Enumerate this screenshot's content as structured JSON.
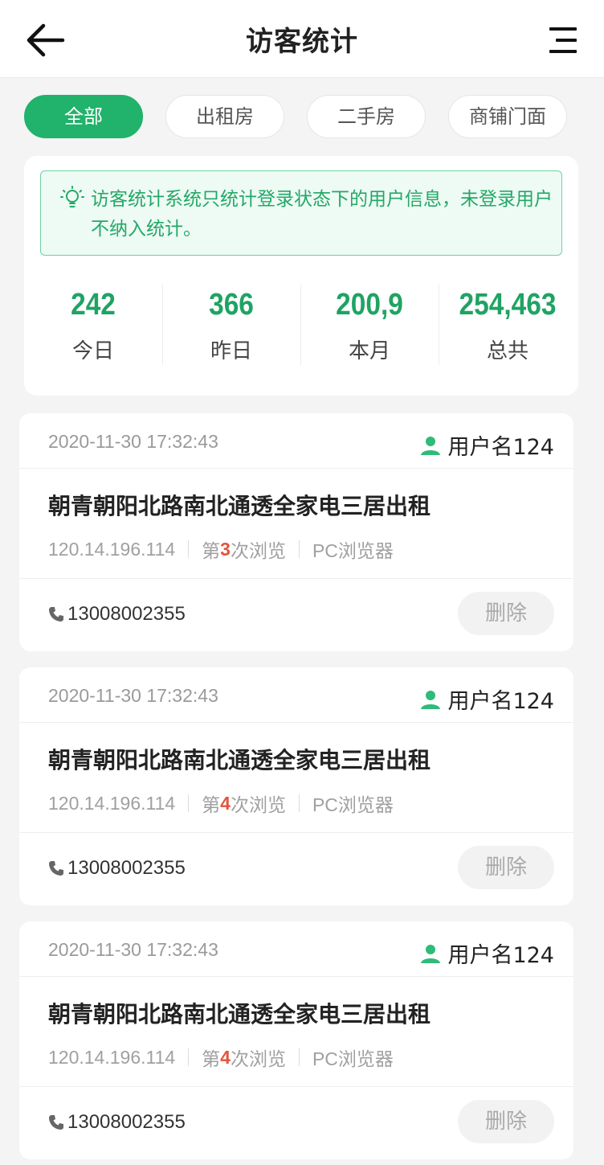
{
  "header": {
    "title": "访客统计"
  },
  "filters": [
    "全部",
    "出租房",
    "二手房",
    "商铺门面"
  ],
  "notice": {
    "text": "访客统计系统只统计登录状态下的用户信息，未登录用户不纳入统计。"
  },
  "stats": [
    {
      "value": "242",
      "label": "今日"
    },
    {
      "value": "366",
      "label": "昨日"
    },
    {
      "value": "200,9",
      "label": "本月"
    },
    {
      "value": "254,463",
      "label": "总共"
    }
  ],
  "records": [
    {
      "time": "2020-11-30 17:32:43",
      "user": "用户名124",
      "title": "朝青朝阳北路南北通透全家电三居出租",
      "ip": "120.14.196.114",
      "visit_prefix": "第",
      "visit_count": "3",
      "visit_suffix": "次浏览",
      "browser": "PC浏览器",
      "phone": "13008002355",
      "delete_label": "删除"
    },
    {
      "time": "2020-11-30 17:32:43",
      "user": "用户名124",
      "title": "朝青朝阳北路南北通透全家电三居出租",
      "ip": "120.14.196.114",
      "visit_prefix": "第",
      "visit_count": "4",
      "visit_suffix": "次浏览",
      "browser": "PC浏览器",
      "phone": "13008002355",
      "delete_label": "删除"
    },
    {
      "time": "2020-11-30 17:32:43",
      "user": "用户名124",
      "title": "朝青朝阳北路南北通透全家电三居出租",
      "ip": "120.14.196.114",
      "visit_prefix": "第",
      "visit_count": "4",
      "visit_suffix": "次浏览",
      "browser": "PC浏览器",
      "phone": "13008002355",
      "delete_label": "删除"
    }
  ],
  "colors": {
    "accent": "#21b26b",
    "stat_number": "#1fa363",
    "visit_count": "#e5533c"
  },
  "icons": [
    "back-arrow-icon",
    "menu-icon",
    "lightbulb-icon",
    "user-icon",
    "phone-icon"
  ]
}
